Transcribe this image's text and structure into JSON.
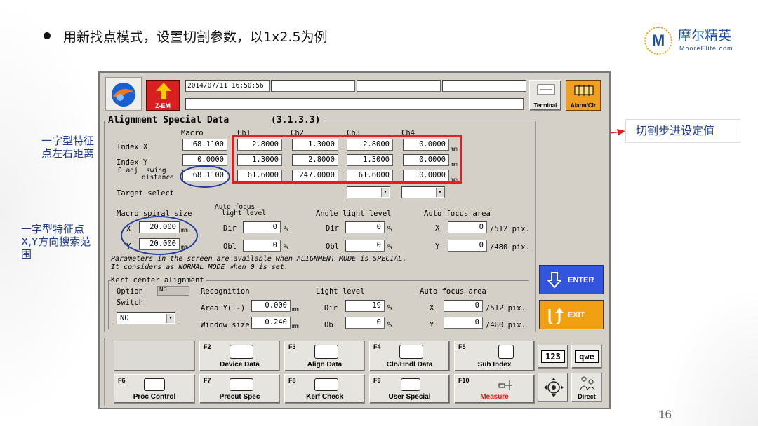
{
  "slide": {
    "heading": "用新找点模式，设置切割参数，以1x2.5为例",
    "logo_mark": "M",
    "logo_cn": "摩尔精英",
    "logo_en": "MooreElite.com",
    "page_number": "16"
  },
  "annotations": {
    "left_top": [
      "一字型特征",
      "点左右距离"
    ],
    "left_mid": [
      "一字型特征点",
      "X,Y方向搜索范",
      "围"
    ],
    "right": "切割步进设定值"
  },
  "colors": {
    "highlight_red": "#e21f1f",
    "highlight_blue": "#1f3f9f",
    "enter_blue": "#3355dd",
    "exit_orange": "#f0a010"
  },
  "app": {
    "datetime": "2014/07/11 16:50:56",
    "zem_label": "Z-EM",
    "terminal_label": "Terminal",
    "alarm_label": "Alarm/Clr",
    "title": "Alignment Special Data",
    "section_code": "(3.1.3.3)",
    "col_headers": [
      "Macro",
      "Ch1",
      "Ch2",
      "Ch3",
      "Ch4"
    ],
    "rows": {
      "index_x": {
        "label": "Index X",
        "macro": "68.1100",
        "ch": [
          "2.8000",
          "1.3000",
          "2.8000",
          "0.0000"
        ],
        "unit": "mm"
      },
      "index_y": {
        "label": "Index Y",
        "macro": "0.0000",
        "ch": [
          "1.3000",
          "2.8000",
          "1.3000",
          "0.0000"
        ],
        "unit": "mm"
      },
      "theta": {
        "label1": "θ adj. swing",
        "label2": "distance",
        "macro": "68.1100",
        "ch": [
          "61.6000",
          "247.0000",
          "61.6000",
          "0.0000"
        ],
        "unit": "mm"
      }
    },
    "target_select": "Target select",
    "macro_spiral": {
      "label": "Macro spiral size",
      "x_label": "X",
      "x": "20.000",
      "y_label": "Y",
      "y": "20.000",
      "unit": "mm"
    },
    "auto_focus_light": {
      "label1": "Auto focus",
      "label2": "light level",
      "dir_label": "Dir",
      "dir": "0",
      "obl_label": "Obl",
      "obl": "0",
      "unit": "%"
    },
    "angle_light": {
      "label": "Angle light level",
      "dir_label": "Dir",
      "dir": "0",
      "obl_label": "Obl",
      "obl": "0",
      "unit": "%"
    },
    "auto_focus_area": {
      "label": "Auto focus area",
      "x_label": "X",
      "x": "0",
      "x_unit": "/512 pix.",
      "y_label": "Y",
      "y": "0",
      "y_unit": "/480 pix."
    },
    "note1": "Parameters in the screen are available when ALIGNMENT MODE is SPECIAL.",
    "note2": "It considers as NORMAL MODE when 0 is set.",
    "kerf": {
      "title": "Kerf center alignment",
      "option_label": "Option",
      "option_value": "NO",
      "switch_label": "Switch",
      "switch_value": "NO",
      "recognition_label": "Recognition",
      "area_label": "Area Y(+-)",
      "area": "0.000",
      "window_label": "Window size",
      "window": "0.240",
      "mm": "mm",
      "light_label": "Light level",
      "dir_label": "Dir",
      "dir": "19",
      "obl_label": "Obl",
      "obl": "0",
      "pct": "%",
      "afa_label": "Auto focus area",
      "x_label": "X",
      "x": "0",
      "x_unit": "/512 pix.",
      "y_label": "Y",
      "y": "0",
      "y_unit": "/480 pix."
    },
    "enter_label": "ENTER",
    "exit_label": "EXIT",
    "fkeys_top": [
      {
        "key": "F2",
        "label": "Device Data"
      },
      {
        "key": "F3",
        "label": "Align Data"
      },
      {
        "key": "F4",
        "label": "Cln/Hndl Data"
      },
      {
        "key": "F5",
        "label": "Sub Index"
      }
    ],
    "fkeys_bottom": [
      {
        "key": "F6",
        "label": "Proc Control"
      },
      {
        "key": "F7",
        "label": "Precut Spec"
      },
      {
        "key": "F8",
        "label": "Kerf Check"
      },
      {
        "key": "F9",
        "label": "User Special"
      },
      {
        "key": "F10",
        "label": "Measure"
      }
    ],
    "kb_123": "123",
    "kb_qwe": "qwe",
    "direct_label": "Direct"
  }
}
